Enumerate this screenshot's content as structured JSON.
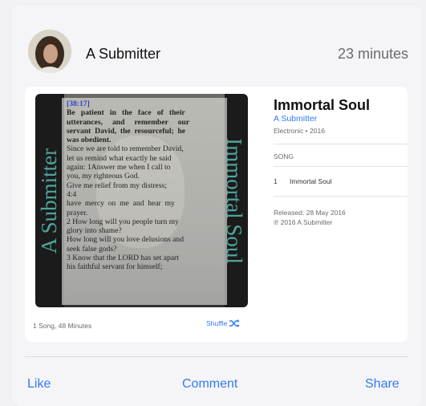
{
  "post": {
    "author": "A Submitter",
    "time": "23 minutes"
  },
  "album": {
    "title": "Immortal Soul",
    "artist": "A Submitter",
    "meta": "Electronic • 2016",
    "section_label": "SONG",
    "tracks": [
      {
        "number": "1",
        "name": "Immortal Soul"
      }
    ],
    "released": "Released:  28 May 2016",
    "copyright": "℗ 2016 A Submitter",
    "song_count": "1 Song, 48 Minutes",
    "shuffle_label": "Shuffle"
  },
  "cover": {
    "spine_left": "A Submitter",
    "spine_right": "Immortal Soul",
    "verse_ref": "[38:17]",
    "verse_bold": "Be   patient   in   the   face   of   their\nutterances,     and     remember     our\nservant  David,  the  resourceful;  he\nwas obedient.",
    "verse_body": "Since we are told to remember David,\nlet us remind what exactly he said\nagain: 1Answer me when I call to\nyou, my righteous God.\nGive me relief from my distress;\n4:4\nhave  mercy  on  me  and  hear  my\nprayer.\n2 How long will you people turn my\nglory into shame?\nHow long will you love delusions and\nseek false gods?\n3 Know that the LORD has set apart\nhis faithful servant for himself;"
  },
  "actions": {
    "like": "Like",
    "comment": "Comment",
    "share": "Share"
  },
  "colors": {
    "accent": "#3478f6",
    "spine_text": "#4fa59b"
  }
}
